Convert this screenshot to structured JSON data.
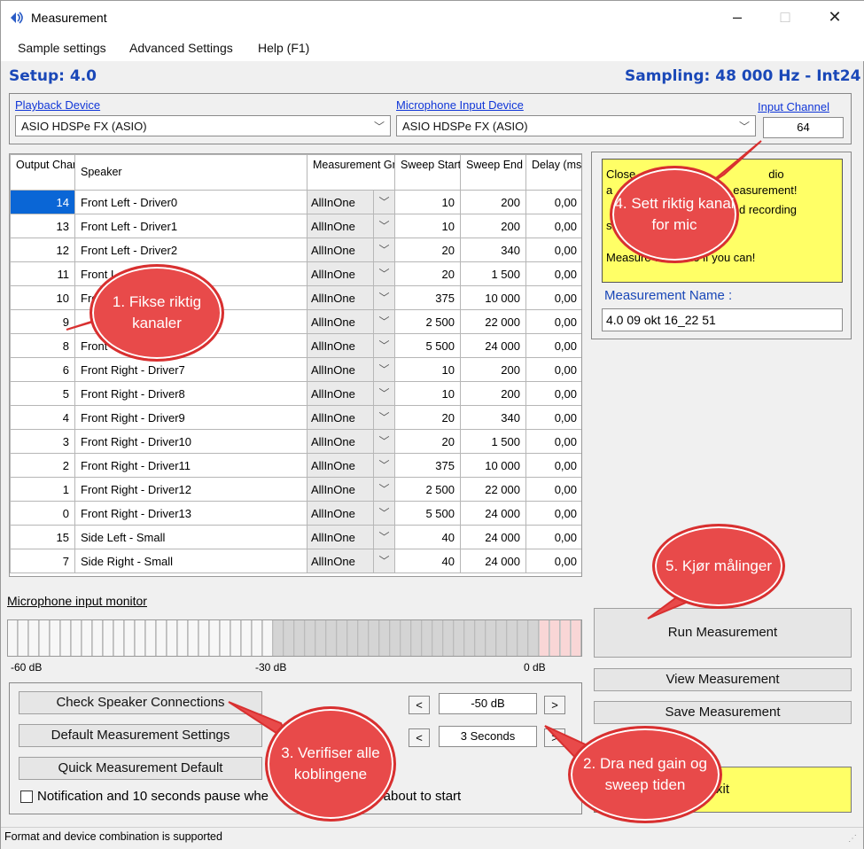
{
  "window": {
    "title": "Measurement",
    "min": "–",
    "max": "□",
    "close": "✕"
  },
  "menu": [
    "Sample settings",
    "Advanced Settings",
    "Help (F1)"
  ],
  "setup_label": "Setup: 4.0",
  "sampling_label": "Sampling: 48 000 Hz - Int24",
  "playback": {
    "label": "Playback Device",
    "value": "ASIO HDSPe FX (ASIO)"
  },
  "microphone": {
    "label": "Microphone Input Device",
    "value": "ASIO HDSPe FX (ASIO)"
  },
  "input_channel": {
    "label": "Input Channel",
    "value": "64"
  },
  "table": {
    "headers": [
      "Output Channel",
      "Speaker",
      "Measurement Group",
      "Sweep Start (Hz)",
      "Sweep End (Hz)",
      "Delay (msec)"
    ],
    "rows": [
      [
        "14",
        "Front Left - Driver0",
        "AllInOne",
        "10",
        "200",
        "0,00"
      ],
      [
        "13",
        "Front Left - Driver1",
        "AllInOne",
        "10",
        "200",
        "0,00"
      ],
      [
        "12",
        "Front Left - Driver2",
        "AllInOne",
        "20",
        "340",
        "0,00"
      ],
      [
        "11",
        "Front L",
        "AllInOne",
        "20",
        "1 500",
        "0,00"
      ],
      [
        "10",
        "Fro",
        "AllInOne",
        "375",
        "10 000",
        "0,00"
      ],
      [
        "9",
        "",
        "AllInOne",
        "2 500",
        "22 000",
        "0,00"
      ],
      [
        "8",
        "Front",
        "AllInOne",
        "5 500",
        "24 000",
        "0,00"
      ],
      [
        "6",
        "Front Right - Driver7",
        "AllInOne",
        "10",
        "200",
        "0,00"
      ],
      [
        "5",
        "Front Right - Driver8",
        "AllInOne",
        "10",
        "200",
        "0,00"
      ],
      [
        "4",
        "Front Right - Driver9",
        "AllInOne",
        "20",
        "340",
        "0,00"
      ],
      [
        "3",
        "Front Right - Driver10",
        "AllInOne",
        "20",
        "1 500",
        "0,00"
      ],
      [
        "2",
        "Front Right - Driver11",
        "AllInOne",
        "375",
        "10 000",
        "0,00"
      ],
      [
        "1",
        "Front Right - Driver12",
        "AllInOne",
        "2 500",
        "22 000",
        "0,00"
      ],
      [
        "0",
        "Front Right - Driver13",
        "AllInOne",
        "5 500",
        "24 000",
        "0,00"
      ],
      [
        "15",
        "Side Left - Small",
        "AllInOne",
        "40",
        "24 000",
        "0,00"
      ],
      [
        "7",
        "Side Right - Small",
        "AllInOne",
        "40",
        "24 000",
        "0,00"
      ]
    ]
  },
  "note": {
    "line1": "Close",
    "line1b": "dio",
    "line2a": "a",
    "line2b": "easurement!",
    "line3": "d recording",
    "line4": "s",
    "line5": "Measure with Asio if you can!"
  },
  "measurement_name": {
    "label": "Measurement Name :",
    "value": "4.0 09 okt 16_22 51"
  },
  "monitor": {
    "label": "Microphone input monitor",
    "scale_left": "-60 dB",
    "scale_mid": "-30 dB",
    "scale_right": "0 dB"
  },
  "buttons": {
    "check": "Check Speaker Connections",
    "default_settings": "Default Measurement Settings",
    "quick_default": "Quick Measurement Default",
    "run": "Run Measurement",
    "view": "View Measurement",
    "save": "Save Measurement",
    "exit": "xit"
  },
  "gain": {
    "value": "-50 dB",
    "dec": "<",
    "inc": ">"
  },
  "sweep_time": {
    "value": "3 Seconds",
    "dec": "<",
    "inc": ">"
  },
  "notification_label": "Notification and 10 seconds pause whe",
  "notification_label_end": "s about to start",
  "status": "Format and device combination is supported",
  "callouts": [
    {
      "text": "1. Fikse riktig kanaler"
    },
    {
      "text": "2. Dra ned gain og sweep tiden"
    },
    {
      "text": "3. Verifiser alle koblingene"
    },
    {
      "text": "4. Sett riktig kanal for mic"
    },
    {
      "text": "5. Kjør målinger"
    }
  ],
  "colors": {
    "accent": "#1a48b8",
    "callout": "#e84a4a",
    "note_bg": "#ffff66",
    "selection": "#0a66d6"
  }
}
